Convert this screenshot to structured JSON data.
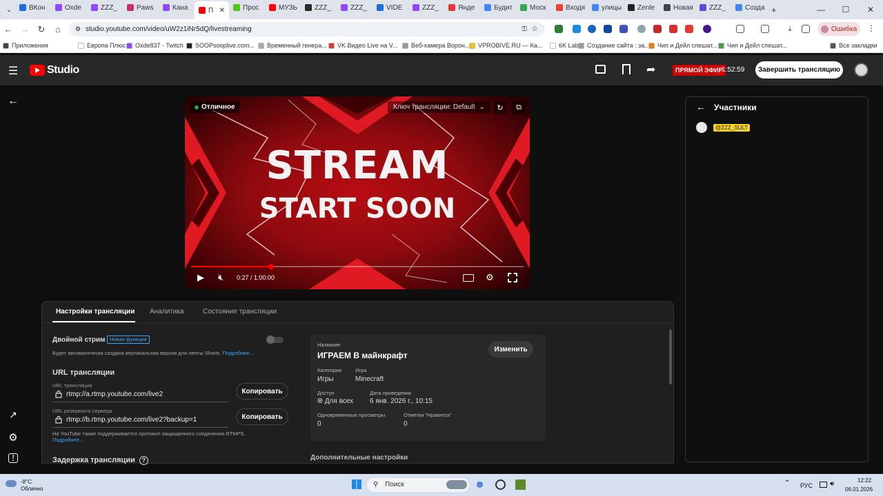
{
  "browser": {
    "tabs": [
      {
        "label": "ВКон",
        "color": "#1e6fd9"
      },
      {
        "label": "Oxde",
        "color": "#9146ff"
      },
      {
        "label": "ZZZ_",
        "color": "#9146ff"
      },
      {
        "label": "Paws",
        "color": "#cc2e6e"
      },
      {
        "label": "Кана",
        "color": "#9146ff"
      },
      {
        "label": "П",
        "color": "#ff0000",
        "active": true
      },
      {
        "label": "Прос",
        "color": "#53c41a"
      },
      {
        "label": "МУЗЬ",
        "color": "#ff0000"
      },
      {
        "label": "ZZZ_",
        "color": "#2a2a2a"
      },
      {
        "label": "ZZZ_",
        "color": "#9146ff"
      },
      {
        "label": "VIDE",
        "color": "#1e6fd9"
      },
      {
        "label": "ZZZ_",
        "color": "#9146ff"
      },
      {
        "label": "Янде",
        "color": "#e53935"
      },
      {
        "label": "Будит",
        "color": "#4285f4"
      },
      {
        "label": "Моск",
        "color": "#34a853"
      },
      {
        "label": "Входя",
        "color": "#ea4335"
      },
      {
        "label": "улицы",
        "color": "#4285f4"
      },
      {
        "label": "Zenle",
        "color": "#222222"
      },
      {
        "label": "Новая",
        "color": "#444444"
      },
      {
        "label": "ZZZ_",
        "color": "#5b4bdb"
      },
      {
        "label": "Созда",
        "color": "#4285f4"
      }
    ],
    "url": "studio.youtube.com/video/uW2z1iNr5dQ/livestreaming",
    "error_label": "Ошибка",
    "bookmarks": [
      {
        "label": "Приложения",
        "color": "#444"
      },
      {
        "label": "Европа Плюс",
        "color": "#ffffff"
      },
      {
        "label": "Oxde837 - Twitch",
        "color": "#9146ff"
      },
      {
        "label": "SOOPsooplive.com...",
        "color": "#222"
      },
      {
        "label": "Временный генера...",
        "color": "#aaa"
      },
      {
        "label": "VK Видео Live на V...",
        "color": "#e53935"
      },
      {
        "label": "Веб-камера Ворон...",
        "color": "#999"
      },
      {
        "label": "VPROBIVE.RU — Ка...",
        "color": "#f4c20d"
      },
      {
        "label": "6K Labs",
        "color": "#ffffff"
      },
      {
        "label": "Создание сайта : за...",
        "color": "#999"
      },
      {
        "label": "Чип и Дейл спешат...",
        "color": "#f57c00"
      },
      {
        "label": "Чип и Дейл спешат...",
        "color": "#43a047"
      },
      {
        "label": "Все закладки",
        "color": "#555"
      }
    ]
  },
  "studio": {
    "logo_text": "Studio",
    "live_badge": "ПРЯМОЙ ЭФИР",
    "live_timer": "1:52:59",
    "end_stream": "Завершить трансляцию"
  },
  "video": {
    "quality": "Отличное",
    "stream_key": "Ключ трансляции: Default",
    "headline_1": "STREAM",
    "headline_2": "START SOON",
    "time": "0:27 / 1:00:00",
    "progress_fraction": 0.24
  },
  "participants": {
    "title": "Участники",
    "items": [
      {
        "name": "@ZZZ_SULT"
      }
    ]
  },
  "settings": {
    "tabs": [
      {
        "label": "Настройки трансляции",
        "active": true
      },
      {
        "label": "Аналитика"
      },
      {
        "label": "Состояние трансляции"
      }
    ],
    "dual_stream_label": "Двойной стрим",
    "new_feature": "Новая функция",
    "dual_stream_desc": "Будет автоматически создана вертикальная версия для ленты Shorts.",
    "more_link": "Подробнее...",
    "url_section": "URL трансляции",
    "url_label": "URL трансляции",
    "url_value": "rtmp://a.rtmp.youtube.com/live2",
    "backup_label": "URL резервного сервера",
    "backup_value": "rtmp://b.rtmp.youtube.com/live2?backup=1",
    "copy_label": "Копировать",
    "rtmps_note": "На YouTube также поддерживается протокол защищенного соединения RTMPS.",
    "rtmps_more": "Подробнее...",
    "latency_label": "Задержка трансляции",
    "advanced_label": "Дополнительные настройки"
  },
  "info": {
    "title_label": "Название",
    "title_value": "ИГРАЕМ В майнкрафт",
    "edit_label": "Изменить",
    "category_label": "Категория",
    "category_value": "Игры",
    "game_label": "Игра",
    "game_value": "Minecraft",
    "access_label": "Доступ",
    "access_value": "Для всех",
    "date_label": "Дата проведения",
    "date_value": "6 янв. 2026 г., 10:15",
    "viewers_label": "Одновременные просмотры",
    "viewers_value": "0",
    "likes_label": "Отметки \"Нравится\"",
    "likes_value": "0"
  },
  "taskbar": {
    "weather_temp": "-8°C",
    "weather_desc": "Облачно",
    "search_placeholder": "Поиск",
    "lang": "РУС",
    "time": "12:22",
    "date": "06.01.2026"
  }
}
